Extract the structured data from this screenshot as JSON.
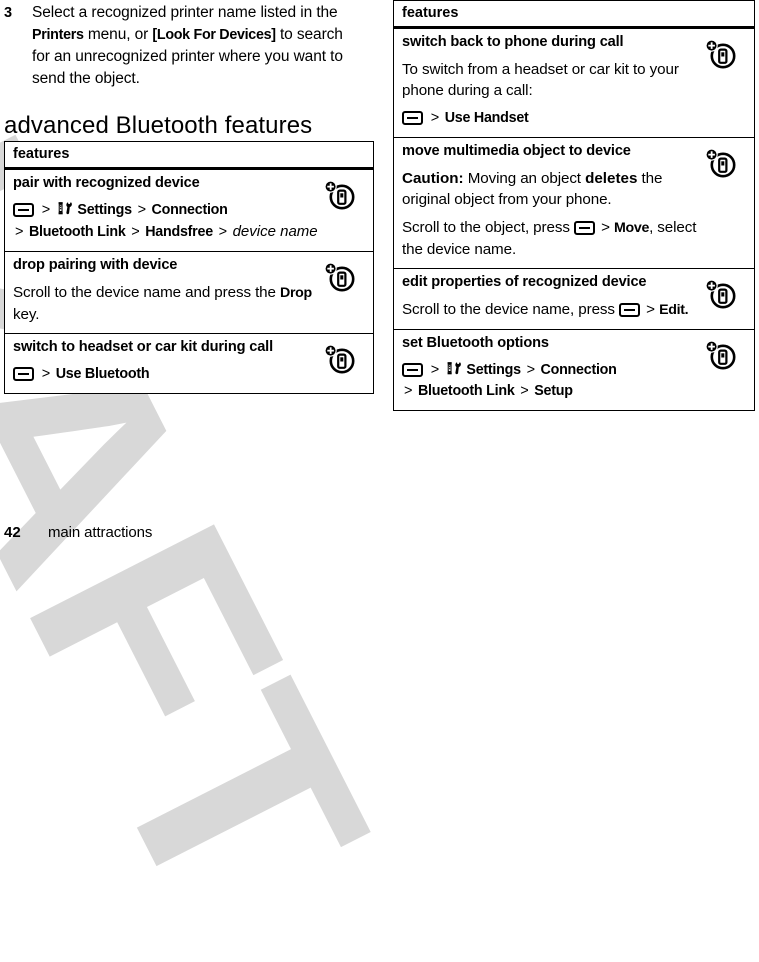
{
  "document": {
    "watermark": "DRAFT",
    "page_number": "42",
    "footer_title": "main attractions"
  },
  "left_column": {
    "step": {
      "number": "3",
      "parts": [
        {
          "t": "Select a recognized printer name listed in the ",
          "b": false
        },
        {
          "t": "Printers",
          "b": true
        },
        {
          "t": " menu, or ",
          "b": false
        },
        {
          "t": "[Look For Devices]",
          "b": true
        },
        {
          "t": " to search for an unrecognized printer where you want to send the object.",
          "b": false
        }
      ]
    },
    "section_heading": "advanced Bluetooth features",
    "table": {
      "header": "features",
      "rows": [
        {
          "title": "pair with recognized device",
          "icon": "bluetooth-device-icon",
          "path": {
            "key": "menu-key-icon",
            "segments": [
              "Settings",
              "Connection",
              "Bluetooth Link",
              "Handsfree"
            ],
            "gear_before": "Settings",
            "italic_tail": "device name"
          }
        },
        {
          "title": "drop pairing with device",
          "icon": "bluetooth-device-icon",
          "paragraph": [
            {
              "t": "Scroll to the device name and press the ",
              "b": false
            },
            {
              "t": "Drop",
              "b": true
            },
            {
              "t": " key.",
              "b": false
            }
          ]
        },
        {
          "title": "switch to headset or car kit during call",
          "icon": "bluetooth-device-icon",
          "path": {
            "key": "menu-key-icon",
            "segments": [
              "Use Bluetooth"
            ]
          }
        }
      ]
    }
  },
  "right_column": {
    "table": {
      "header": "features",
      "rows": [
        {
          "title": "switch back to phone during call",
          "icon": "bluetooth-device-icon",
          "paragraph": [
            {
              "t": "To switch from a headset or car kit to your phone during a call:",
              "b": false
            }
          ],
          "path": {
            "key": "menu-key-icon",
            "segments": [
              "Use Handset"
            ]
          }
        },
        {
          "title": "move multimedia object to device",
          "icon": "bluetooth-device-icon",
          "paragraph": [
            {
              "t": "Caution:",
              "b": true
            },
            {
              "t": " Moving an object ",
              "b": false
            },
            {
              "t": "deletes",
              "b": true
            },
            {
              "t": " the original object from your phone.",
              "b": false
            }
          ],
          "paragraph2_pre": "Scroll to the object, press ",
          "paragraph2_key": "menu-key-icon",
          "paragraph2_gt": ">",
          "paragraph2_bold": "Move",
          "paragraph2_post": ", select the device name."
        },
        {
          "title": "edit properties of recognized device",
          "icon": "bluetooth-device-icon",
          "paragraph2_pre": "Scroll to the device name, press ",
          "paragraph2_key": "menu-key-icon",
          "paragraph2_gt": ">",
          "paragraph2_bold": "Edit.",
          "paragraph2_post": ""
        },
        {
          "title": "set Bluetooth options",
          "icon": "bluetooth-device-icon",
          "path": {
            "key": "menu-key-icon",
            "segments": [
              "Settings",
              "Connection",
              "Bluetooth Link",
              "Setup"
            ],
            "gear_before": "Settings"
          }
        }
      ]
    }
  },
  "colors": {
    "ink": "#000000",
    "paper": "#ffffff",
    "watermark": "#d8d8d8"
  }
}
